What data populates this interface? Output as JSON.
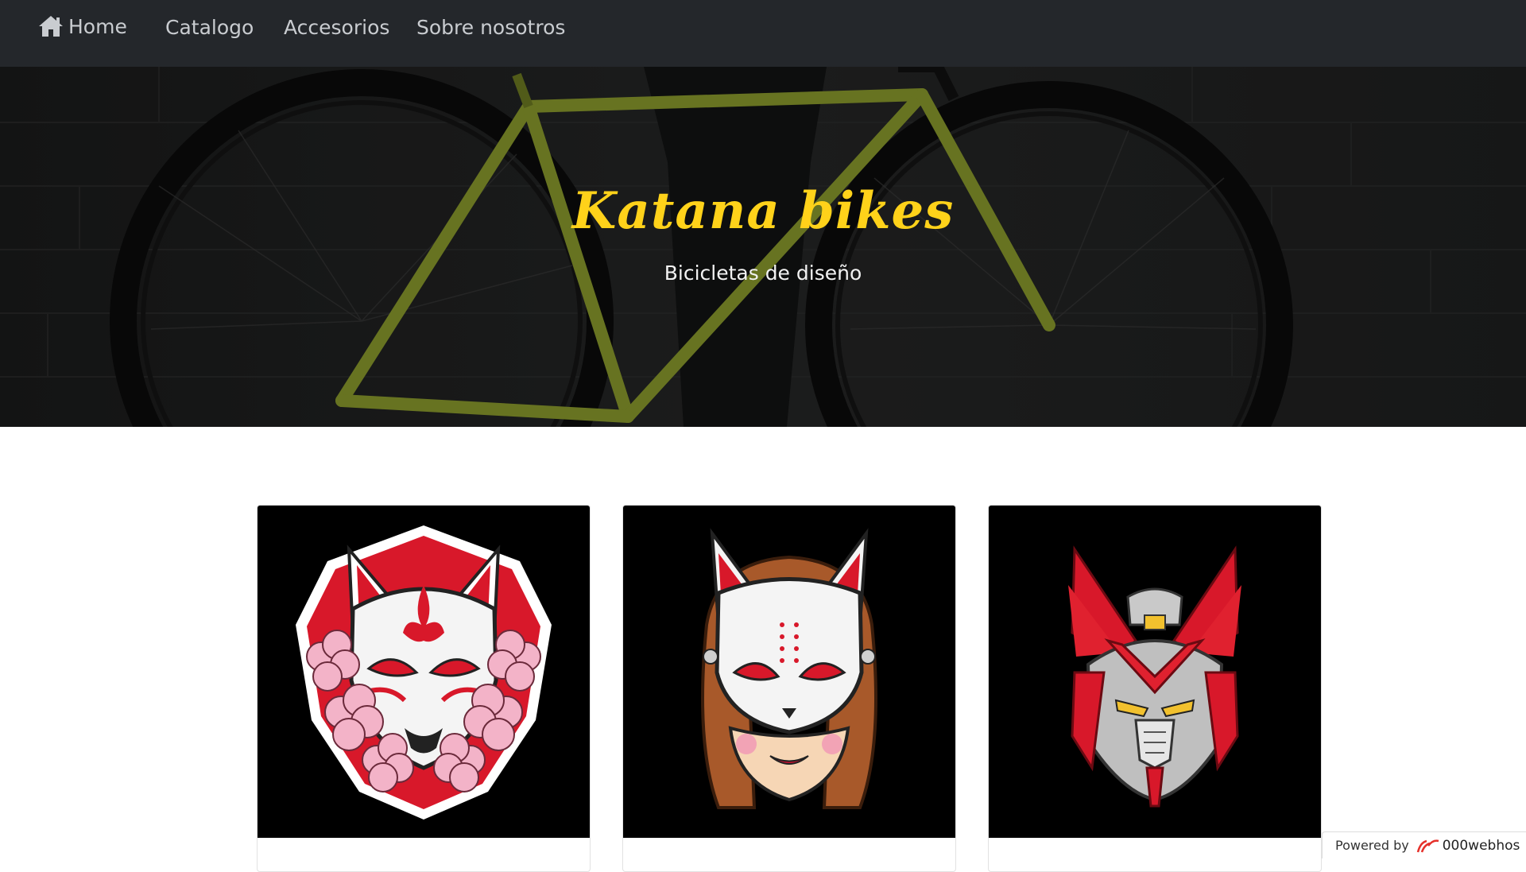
{
  "nav": {
    "home_label": "Home",
    "items": [
      {
        "label": "Catalogo"
      },
      {
        "label": "Accesorios"
      },
      {
        "label": "Sobre nosotros"
      }
    ]
  },
  "hero": {
    "title": "Katana bikes",
    "subtitle": "Bicicletas de diseño"
  },
  "cards": [
    {
      "image": "kitsune-mask-sakura-icon"
    },
    {
      "image": "kitsune-mask-girl-icon"
    },
    {
      "image": "mecha-robot-head-icon"
    }
  ],
  "footer_badge": {
    "powered_label": "Powered by",
    "brand": "000webhos"
  },
  "colors": {
    "navbar": "#24272b",
    "title": "#ffd21a",
    "subtitle": "#f2f2f2",
    "accent_red": "#d8182a"
  }
}
